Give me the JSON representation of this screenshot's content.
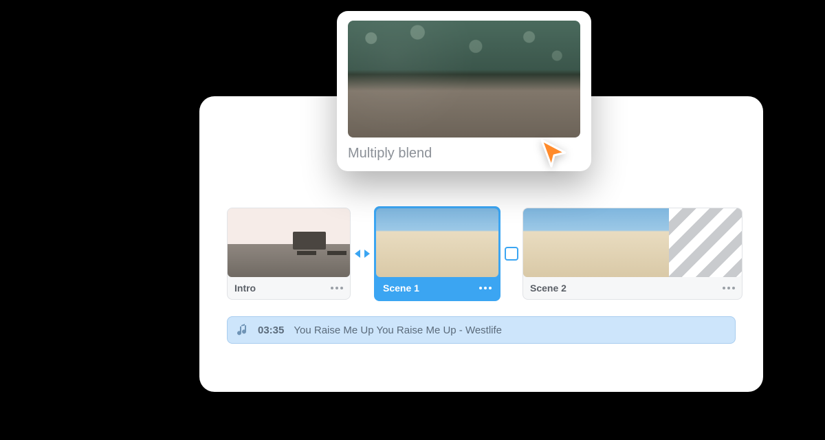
{
  "preview": {
    "label": "Multiply blend"
  },
  "timeline": {
    "scenes": [
      {
        "label": "Intro",
        "selected": false
      },
      {
        "label": "Scene 1",
        "selected": true
      },
      {
        "label": "Scene 2",
        "selected": false
      }
    ]
  },
  "audio": {
    "time": "03:35",
    "title": "You Raise Me Up You Raise Me Up - Westlife"
  },
  "colors": {
    "accent": "#3ba5f2",
    "audio_bg": "#cde5fb",
    "cursor": "#ff8a2a"
  }
}
